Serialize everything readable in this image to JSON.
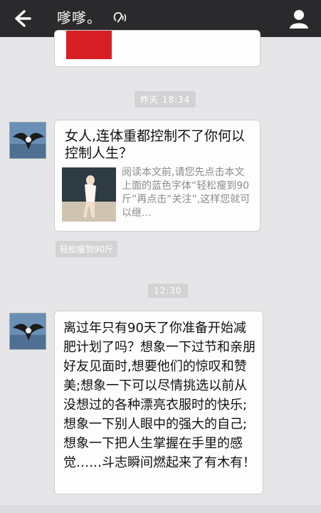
{
  "header": {
    "back_icon": "back-arrow-icon",
    "title": "嗲嗲。",
    "ear_icon": "ear-mode-icon",
    "profile_icon": "profile-icon"
  },
  "messages": {
    "time1": "昨天 18:34",
    "article": {
      "title": "女人,连体重都控制不了你何以控制人生？",
      "description": "阅读本文前,请您先点击本文上面的蓝色字体“轻松瘦到90斤”再点击“关注”,这样您就可以继…",
      "source": "轻松瘦到90斤"
    },
    "time2": "12:30",
    "text": "离过年只有90天了你准备开始减肥计划了吗？想象一下过节和亲朋好友见面时,想要他们的惊叹和赞美;想象一下可以尽情挑选以前从没想过的各种漂亮衣服时的快乐;想象一下别人眼中的强大的自己;想象一下把人生掌握在手里的感觉……斗志瞬间燃起来了有木有！"
  },
  "colors": {
    "topbar": "#2a2a2d",
    "background": "#e6e6e8",
    "bubble": "#fdfdfd",
    "timestamp_chip": "#d3d3d6",
    "accent_red": "#d81e25"
  }
}
